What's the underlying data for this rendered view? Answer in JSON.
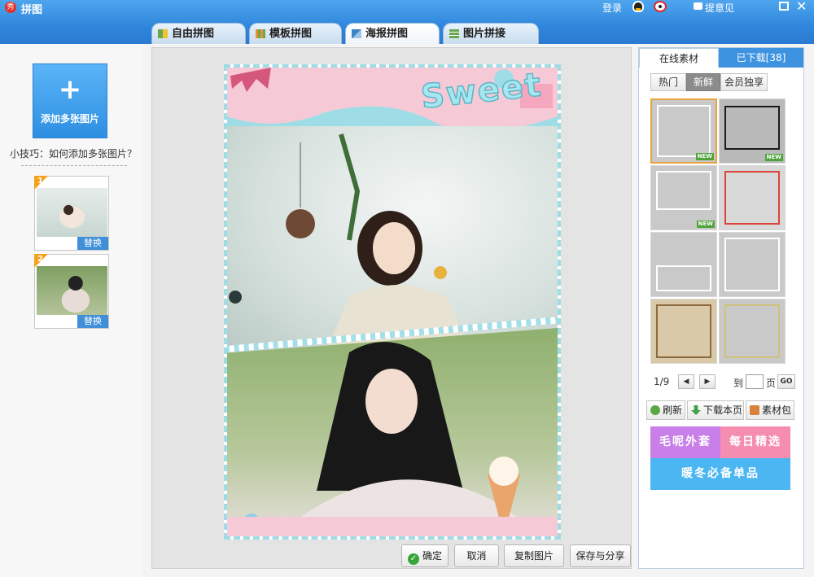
{
  "app": {
    "title": "拼图",
    "icon_char": "秀"
  },
  "titlebar": {
    "login": "登录",
    "feedback": "提意见",
    "close": "✕"
  },
  "tabs": [
    {
      "label": "自由拼图"
    },
    {
      "label": "模板拼图"
    },
    {
      "label": "海报拼图"
    },
    {
      "label": "图片拼接"
    }
  ],
  "left": {
    "add_plus": "+",
    "add_label": "添加多张图片",
    "tip": "小技巧：如何添加多张图片？",
    "thumbs": [
      {
        "num": "1",
        "replace": "替换"
      },
      {
        "num": "2",
        "replace": "替换"
      }
    ]
  },
  "poster": {
    "sweet_text": "Sweet"
  },
  "actions": {
    "ok": "确定",
    "cancel": "取消",
    "copy": "复制图片",
    "save": "保存与分享"
  },
  "right": {
    "tab_online": "在线素材",
    "tab_downloaded": "已下载[38]",
    "filters": [
      "热门",
      "新鲜",
      "会员独享"
    ],
    "new_tag": "NEW",
    "page_info": "1/9",
    "prev": "◀",
    "next": "▶",
    "to_label": "到",
    "page_label": "页",
    "go": "GO",
    "refresh": "刷新",
    "download_page": "下载本页",
    "material_pack": "素材包",
    "ad": [
      "毛呢外套",
      "每日精选",
      "暖冬必备单品"
    ]
  },
  "colors": {
    "accent": "#2f86dc",
    "ad_purple": "#c87fe8",
    "ad_pink": "#f58db1",
    "ad_blue": "#4bb6f2"
  }
}
